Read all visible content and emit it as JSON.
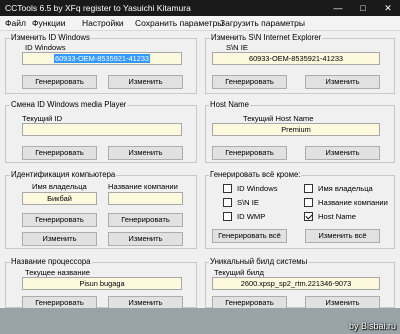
{
  "window": {
    "title": "CCTools 6.5 by XFq register to Yasuichi Kitamura"
  },
  "menu": [
    "Файл",
    "Функции",
    "Настройки",
    "Сохранить параметры",
    "Загрузить параметры"
  ],
  "win_id": {
    "title": "Изменить ID Windows",
    "label": "ID Windows",
    "value": "60933-OEM-8535921-41233",
    "generate": "Генерировать",
    "change": "Изменить"
  },
  "sn_ie": {
    "title": "Изменить S\\N Internet Explorer",
    "label": "S\\N IE",
    "value": "60933-OEM-8535921-41233",
    "generate": "Генерировать",
    "change": "Изменить"
  },
  "wmp": {
    "title": "Смена ID Windows media Player",
    "label": "Текущий ID",
    "value": "",
    "generate": "Генерировать",
    "change": "Изменить"
  },
  "hostname": {
    "title": "Host Name",
    "label": "Текущий Host Name",
    "value": "Premium",
    "generate": "Генерировать",
    "change": "Изменить"
  },
  "ident": {
    "title": "Идентификация компьютера",
    "owner_label": "Имя владельца",
    "owner_value": "Бикбай",
    "company_label": "Название компании",
    "company_value": "",
    "generate": "Генерировать",
    "change": "Изменить"
  },
  "genall": {
    "title": "Генерировать всё кроме:",
    "options": [
      {
        "label": "ID Windows",
        "checked": false
      },
      {
        "label": "S\\N IE",
        "checked": false
      },
      {
        "label": "ID WMP",
        "checked": false
      },
      {
        "label": "Имя владельца",
        "checked": false
      },
      {
        "label": "Название компании",
        "checked": false
      },
      {
        "label": "Host Name",
        "checked": true
      }
    ],
    "generate_all": "Генерировать всё",
    "change_all": "Изменить всё"
  },
  "processor": {
    "title": "Название процессора",
    "label": "Текущее название",
    "value": "Pisun bugaga",
    "generate": "Генерировать",
    "change": "Изменить"
  },
  "build": {
    "title": "Уникальный билд системы",
    "label": "Текущий билд",
    "value": "2600.xpsp_sp2_rtm.221346-9073",
    "generate": "Генерировать",
    "change": "Изменить"
  },
  "watermark": "by Bisbai.ru"
}
